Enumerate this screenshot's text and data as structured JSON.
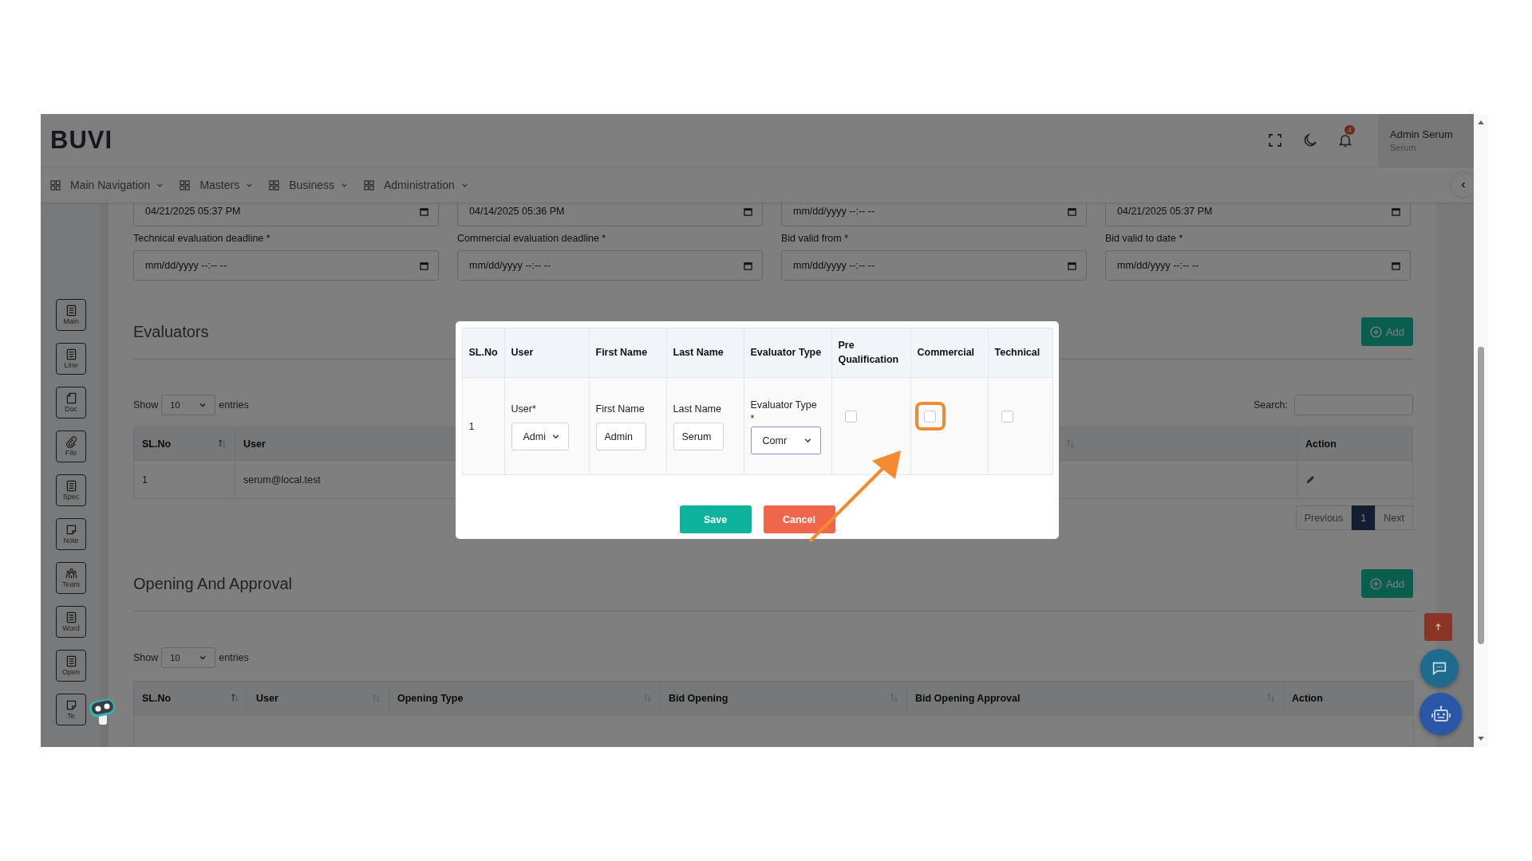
{
  "app": {
    "logo": "BUVI",
    "notification_count": "4",
    "user": {
      "name": "Admin Serum",
      "role": "Serum"
    }
  },
  "nav": [
    {
      "label": "Main Navigation"
    },
    {
      "label": "Masters"
    },
    {
      "label": "Business"
    },
    {
      "label": "Administration"
    }
  ],
  "sidebar": [
    {
      "label": "Main"
    },
    {
      "label": "Line"
    },
    {
      "label": "Doc"
    },
    {
      "label": "File"
    },
    {
      "label": "Spec"
    },
    {
      "label": "Note"
    },
    {
      "label": "Team"
    },
    {
      "label": "Word"
    },
    {
      "label": "Open"
    },
    {
      "label": "Te"
    }
  ],
  "top_dates": [
    {
      "value": "04/21/2025 05:37 PM"
    },
    {
      "value": "04/14/2025 05:36 PM"
    },
    {
      "placeholder": "mm/dd/yyyy --:-- --"
    },
    {
      "value": "04/21/2025 05:37 PM"
    }
  ],
  "date_fields": [
    {
      "label": "Technical evaluation deadline *",
      "placeholder": "mm/dd/yyyy --:-- --"
    },
    {
      "label": "Commercial evaluation deadline *",
      "placeholder": "mm/dd/yyyy --:-- --"
    },
    {
      "label": "Bid valid from *",
      "placeholder": "mm/dd/yyyy --:-- --"
    },
    {
      "label": "Bid valid to date *",
      "placeholder": "mm/dd/yyyy --:-- --"
    }
  ],
  "evaluators": {
    "title": "Evaluators",
    "add_label": "Add",
    "show_label": "Show",
    "page_size": "10",
    "entries_label": "entries",
    "search_label": "Search:",
    "columns": [
      {
        "label": "SL.No",
        "sortable": true,
        "sorted": true
      },
      {
        "label": "User"
      },
      {
        "sortable": true,
        "sorted": false
      },
      {
        "label": "Action"
      }
    ],
    "rows": [
      {
        "cells": [
          "1",
          "serum@local.test"
        ]
      }
    ],
    "pagination": {
      "previous": "Previous",
      "next": "Next",
      "pages": [
        {
          "label": "1",
          "selected": true
        }
      ]
    }
  },
  "opening": {
    "title": "Opening And Approval",
    "add_label": "Add",
    "show_label": "Show",
    "page_size": "10",
    "entries_label": "entries",
    "columns": [
      {
        "label": "SL.No",
        "sortable": true,
        "sorted": true
      },
      {
        "label": "User",
        "sortable": true,
        "sorted": false
      },
      {
        "label": "Opening Type",
        "sortable": true,
        "sorted": false
      },
      {
        "label": "Bid Opening",
        "sortable": true,
        "sorted": false
      },
      {
        "label": "Bid Opening Approval",
        "sortable": true,
        "sorted": false
      },
      {
        "label": "Action"
      }
    ]
  },
  "modal": {
    "columns": [
      "SL.No",
      "User",
      "First Name",
      "Last Name",
      "Evaluator Type",
      "Pre Qualification",
      "Commercial",
      "Technical"
    ],
    "row": {
      "sl_no": "1",
      "user": {
        "label": "User*",
        "value": "Admi"
      },
      "first_name": {
        "label": "First Name",
        "value": "Admin"
      },
      "last_name": {
        "label": "Last Name",
        "value": "Serum"
      },
      "evaluator_type": {
        "label": "Evaluator Type",
        "required_mark": "*",
        "value": "Comr"
      },
      "checks": [
        {
          "checked": false,
          "highlighted": false
        },
        {
          "checked": false,
          "highlighted": true
        },
        {
          "checked": false,
          "highlighted": false
        }
      ]
    },
    "buttons": [
      {
        "label": "Save",
        "kind": "primary"
      },
      {
        "label": "Cancel",
        "kind": "danger"
      }
    ]
  }
}
